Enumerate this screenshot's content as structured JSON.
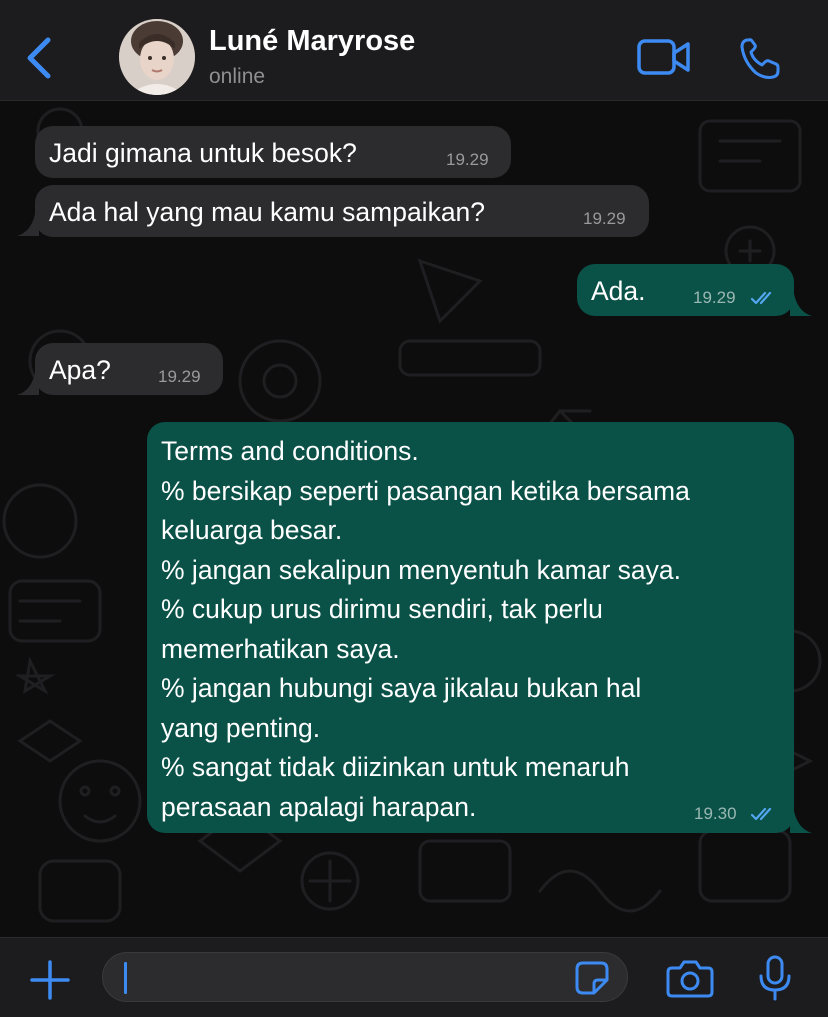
{
  "header": {
    "contact_name": "Luné Maryrose",
    "status": "online",
    "back_icon": "chevron-left-icon",
    "video_icon": "video-camera-icon",
    "call_icon": "phone-icon"
  },
  "colors": {
    "accent": "#3d8bf2",
    "incoming_bubble": "#2c2c2e",
    "outgoing_bubble": "#0a5147",
    "read_ticks": "#53a6f0"
  },
  "messages": [
    {
      "direction": "incoming",
      "text": "Jadi gimana untuk besok?",
      "time": "19.29"
    },
    {
      "direction": "incoming",
      "text": "Ada hal yang mau kamu sampaikan?",
      "time": "19.29"
    },
    {
      "direction": "outgoing",
      "text": "Ada.",
      "time": "19.29",
      "status": "read"
    },
    {
      "direction": "incoming",
      "text": "Apa?",
      "time": "19.29"
    },
    {
      "direction": "outgoing",
      "lines": [
        "Terms and conditions.",
        "% bersikap seperti pasangan ketika bersama",
        "keluarga besar.",
        "% jangan sekalipun menyentuh kamar saya.",
        "% cukup urus dirimu sendiri, tak perlu",
        "memerhatikan saya.",
        "% jangan hubungi saya jikalau bukan hal",
        "yang penting.",
        "% sangat tidak diizinkan untuk menaruh",
        "perasaan apalagi harapan."
      ],
      "time": "19.30",
      "status": "read"
    }
  ],
  "input_bar": {
    "placeholder": "",
    "value": "",
    "icons": [
      "plus-icon",
      "sticker-icon",
      "camera-icon",
      "microphone-icon"
    ]
  }
}
